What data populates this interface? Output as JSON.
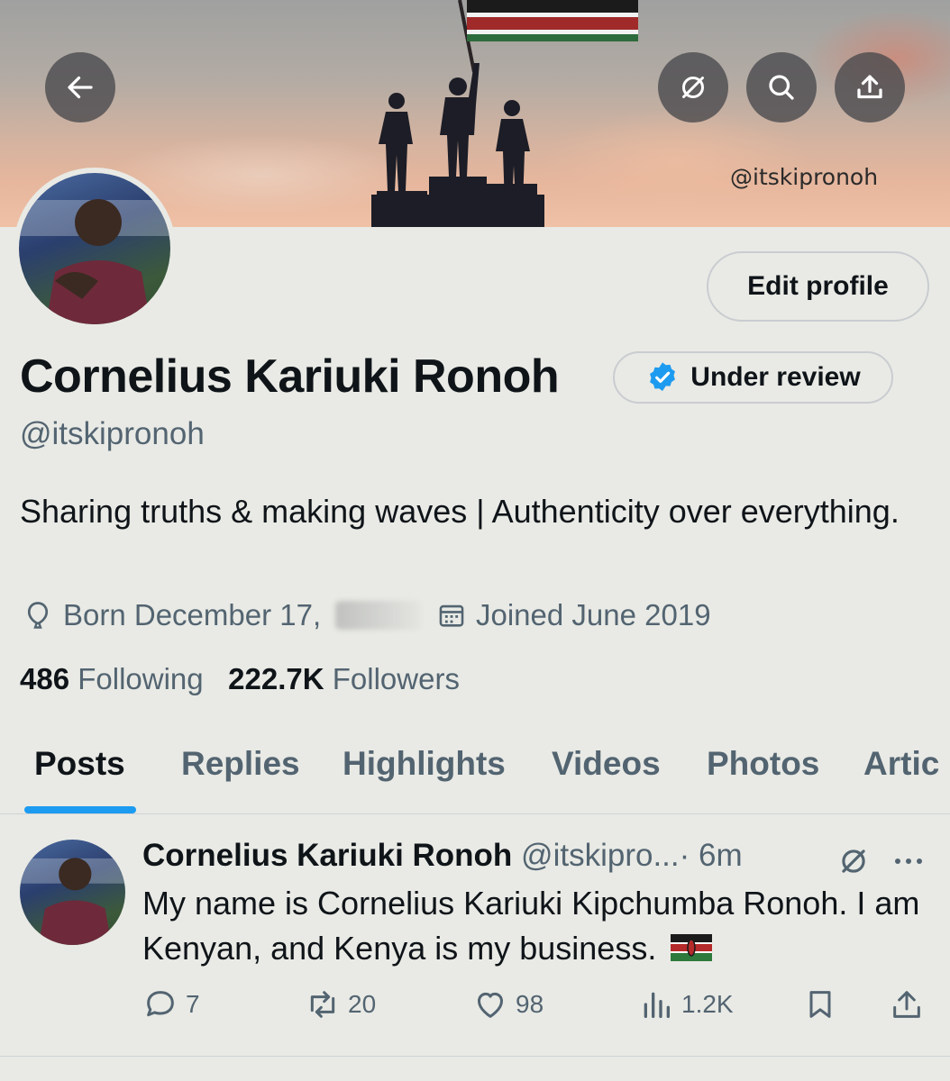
{
  "banner": {
    "watermark_handle": "@itskipronoh"
  },
  "header": {
    "back_icon": "arrow-left-icon",
    "grok_icon": "grok-icon",
    "search_icon": "search-icon",
    "share_icon": "share-icon"
  },
  "profile": {
    "edit_label": "Edit profile",
    "display_name": "Cornelius Kariuki Ronoh",
    "badge_label": "Under review",
    "handle": "@itskipronoh",
    "bio": "Sharing truths & making waves | Authenticity over everything.",
    "born_label": "Born December 17,",
    "joined_label": "Joined June 2019",
    "following_count": "486",
    "following_label": "Following",
    "followers_count": "222.7K",
    "followers_label": "Followers"
  },
  "tabs": [
    {
      "label": "Posts"
    },
    {
      "label": "Replies"
    },
    {
      "label": "Highlights"
    },
    {
      "label": "Videos"
    },
    {
      "label": "Photos"
    },
    {
      "label": "Artic"
    }
  ],
  "post": {
    "author_name": "Cornelius Kariuki Ronoh",
    "author_handle": "@itskipro...",
    "time": "· 6m",
    "text": "My name is Cornelius Kariuki Kipchumba Ronoh. I am Kenyan, and Kenya is my business.",
    "replies": "7",
    "reposts": "20",
    "likes": "98",
    "views": "1.2K"
  },
  "colors": {
    "accent": "#1d9bf0",
    "text": "#0f1419",
    "muted": "#536471",
    "background": "#e9eae5"
  }
}
